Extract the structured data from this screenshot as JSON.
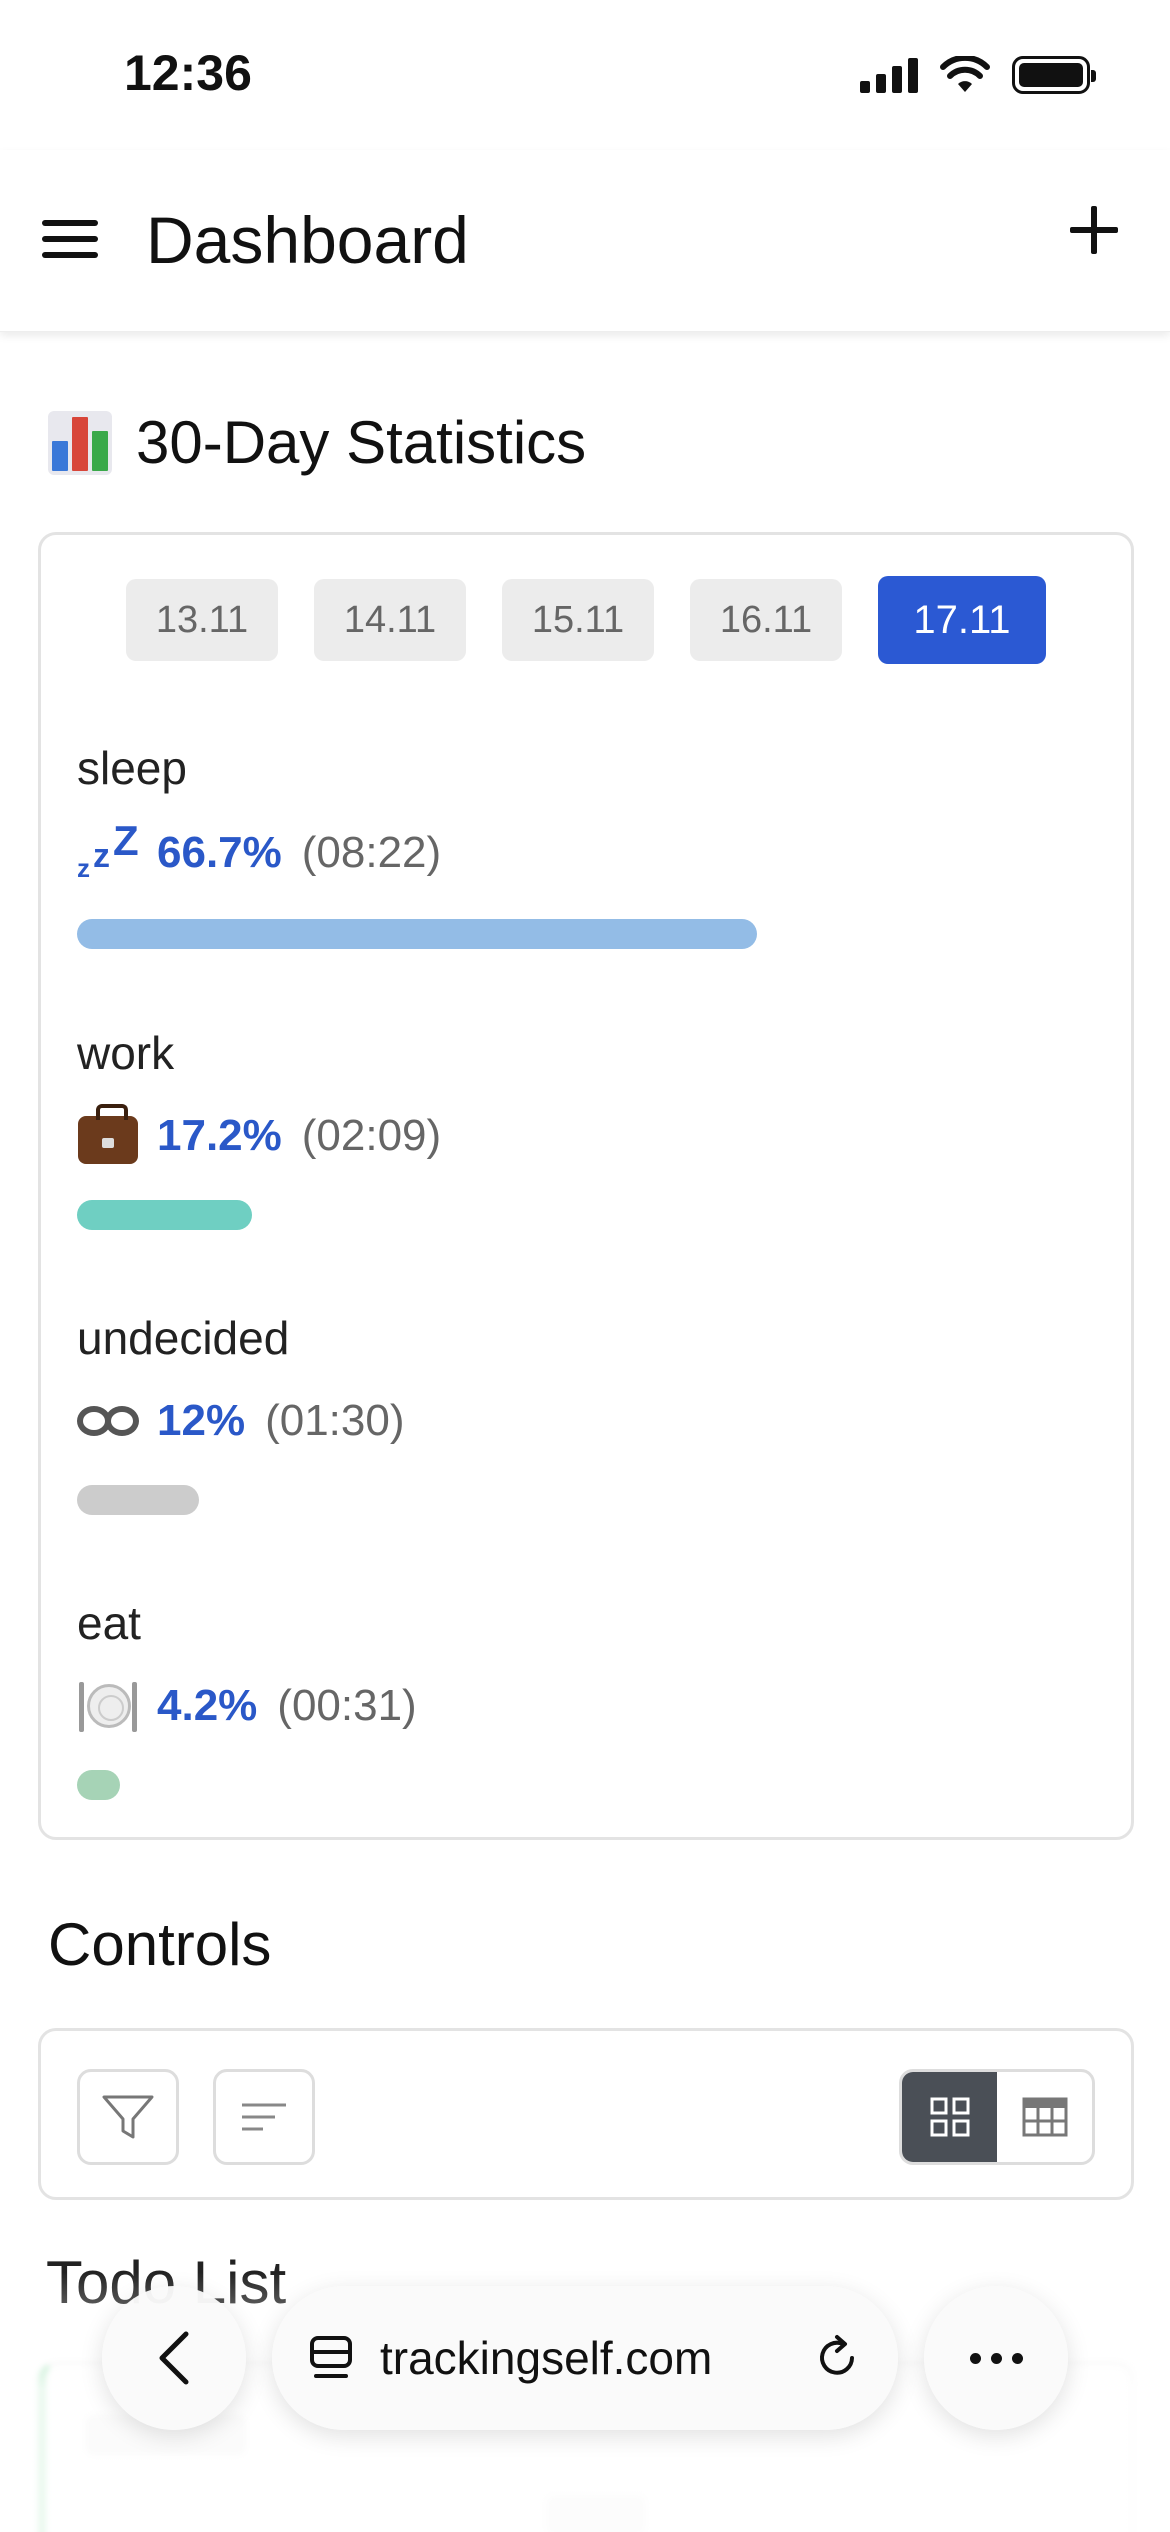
{
  "status_bar": {
    "time": "12:36"
  },
  "header": {
    "title": "Dashboard"
  },
  "stats": {
    "heading": "30-Day Statistics",
    "dates": [
      "13.11",
      "14.11",
      "15.11",
      "16.11",
      "17.11"
    ],
    "active_date": "17.11",
    "items": [
      {
        "label": "sleep",
        "icon": "zzz-icon",
        "percent": "66.7%",
        "duration": "(08:22)",
        "fraction": 0.667,
        "color": "#93bce6"
      },
      {
        "label": "work",
        "icon": "briefcase-icon",
        "percent": "17.2%",
        "duration": "(02:09)",
        "fraction": 0.172,
        "color": "#6fcfc2"
      },
      {
        "label": "undecided",
        "icon": "infinity-icon",
        "percent": "12%",
        "duration": "(01:30)",
        "fraction": 0.12,
        "color": "#cccccc"
      },
      {
        "label": "eat",
        "icon": "plate-icon",
        "percent": "4.2%",
        "duration": "(00:31)",
        "fraction": 0.042,
        "color": "#a6d3b6"
      }
    ]
  },
  "controls": {
    "heading": "Controls"
  },
  "todo": {
    "heading": "Todo List"
  },
  "browser": {
    "url": "trackingself.com"
  },
  "colors": {
    "accent": "#2b59d3",
    "percent_text": "#2a58c8"
  }
}
